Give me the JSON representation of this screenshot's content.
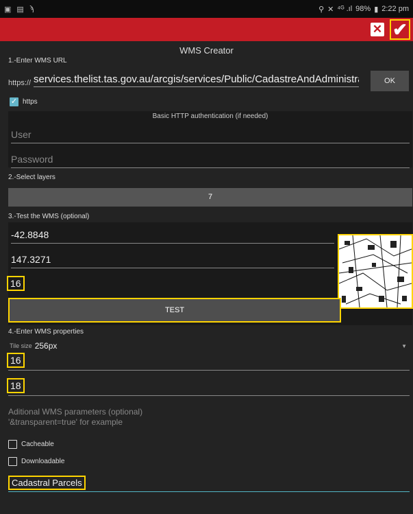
{
  "status_bar": {
    "left_icons": [
      "image-icon",
      "sim-icon",
      "notification-icon"
    ],
    "signal": "⁴ᴳ .ıl",
    "battery": "98%",
    "time": "2:22 pm"
  },
  "app_bar": {
    "close_icon": "close-box-icon",
    "ok_icon": "check-icon",
    "accent": "#c41c25",
    "highlight": "#ffd400"
  },
  "title": "WMS Creator",
  "section1": {
    "label": "1.-Enter WMS URL",
    "url_prefix": "https://",
    "url_value": "services.thelist.tas.gov.au/arcgis/services/Public/CadastreAndAdministrat",
    "ok_label": "OK",
    "https_label": "https",
    "https_checked": true
  },
  "auth": {
    "title": "Basic HTTP authentication (if needed)",
    "user_placeholder": "User",
    "password_placeholder": "Password"
  },
  "section2": {
    "label": "2.-Select layers",
    "layers_count": "7"
  },
  "section3": {
    "label": "3.-Test the WMS (optional)",
    "latitude": "-42.8848",
    "longitude": "147.3271",
    "zoom": "16",
    "test_label": "TEST"
  },
  "section4": {
    "label": "4.-Enter WMS properties",
    "tile_size_label": "Tile size",
    "tile_size_value": "256px",
    "min_zoom": "16",
    "max_zoom": "18",
    "params_line1": "Aditional WMS parameters (optional)",
    "params_line2": "'&transparent=true' for example",
    "cacheable_label": "Cacheable",
    "downloadable_label": "Downloadable",
    "name_value": "Cadastral Parcels"
  }
}
